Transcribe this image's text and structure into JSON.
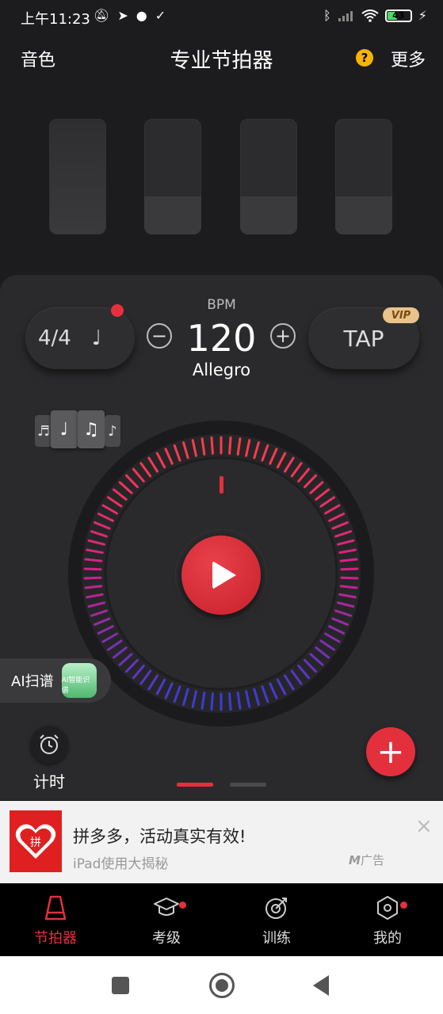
{
  "status_bar": {
    "time": "上午11:23",
    "battery": "43",
    "left_icons": [
      "mute-bell-icon",
      "telegram-icon",
      "chat-icon",
      "check-icon"
    ],
    "right_icons": [
      "bluetooth-icon",
      "signal-icon",
      "wifi-icon",
      "battery-icon",
      "charging-icon"
    ]
  },
  "header": {
    "left": "音色",
    "title": "专业节拍器",
    "help": "?",
    "right": "更多"
  },
  "beats": [
    {
      "accent_level": 1.0
    },
    {
      "accent_level": 0.33
    },
    {
      "accent_level": 0.33
    },
    {
      "accent_level": 0.33
    }
  ],
  "controls": {
    "time_signature": "4/4",
    "note_symbol": "♩",
    "bpm_label": "BPM",
    "bpm": "120",
    "tempo_name": "Allegro",
    "minus": "−",
    "plus": "+",
    "tap": "TAP",
    "vip": "VIP"
  },
  "rhythm_cards": [
    "♬",
    "♩",
    "♫",
    "♪"
  ],
  "dial": {
    "tick_count": 90,
    "gradient_top": "#ff3b4a",
    "gradient_mid": "#d21f8a",
    "gradient_bottom": "#3a3cd8",
    "marker_color": "#e3303c"
  },
  "ai_scan": {
    "label": "AI扫谱",
    "badge": "AI智能识谱"
  },
  "timer": {
    "label": "计时"
  },
  "add_label": "+",
  "ad": {
    "title": "拼多多，活动真实有效!",
    "subtitle": "iPad使用大揭秘",
    "tag": "广告",
    "logo_text": "拼",
    "close": "×"
  },
  "tabs": [
    {
      "label": "节拍器",
      "icon": "metronome-icon",
      "active": true,
      "dot": false
    },
    {
      "label": "考级",
      "icon": "graduation-cap-icon",
      "active": false,
      "dot": true
    },
    {
      "label": "训练",
      "icon": "target-icon",
      "active": false,
      "dot": false
    },
    {
      "label": "我的",
      "icon": "profile-hexagon-icon",
      "active": false,
      "dot": true
    }
  ],
  "accent_color": "#e3303c"
}
